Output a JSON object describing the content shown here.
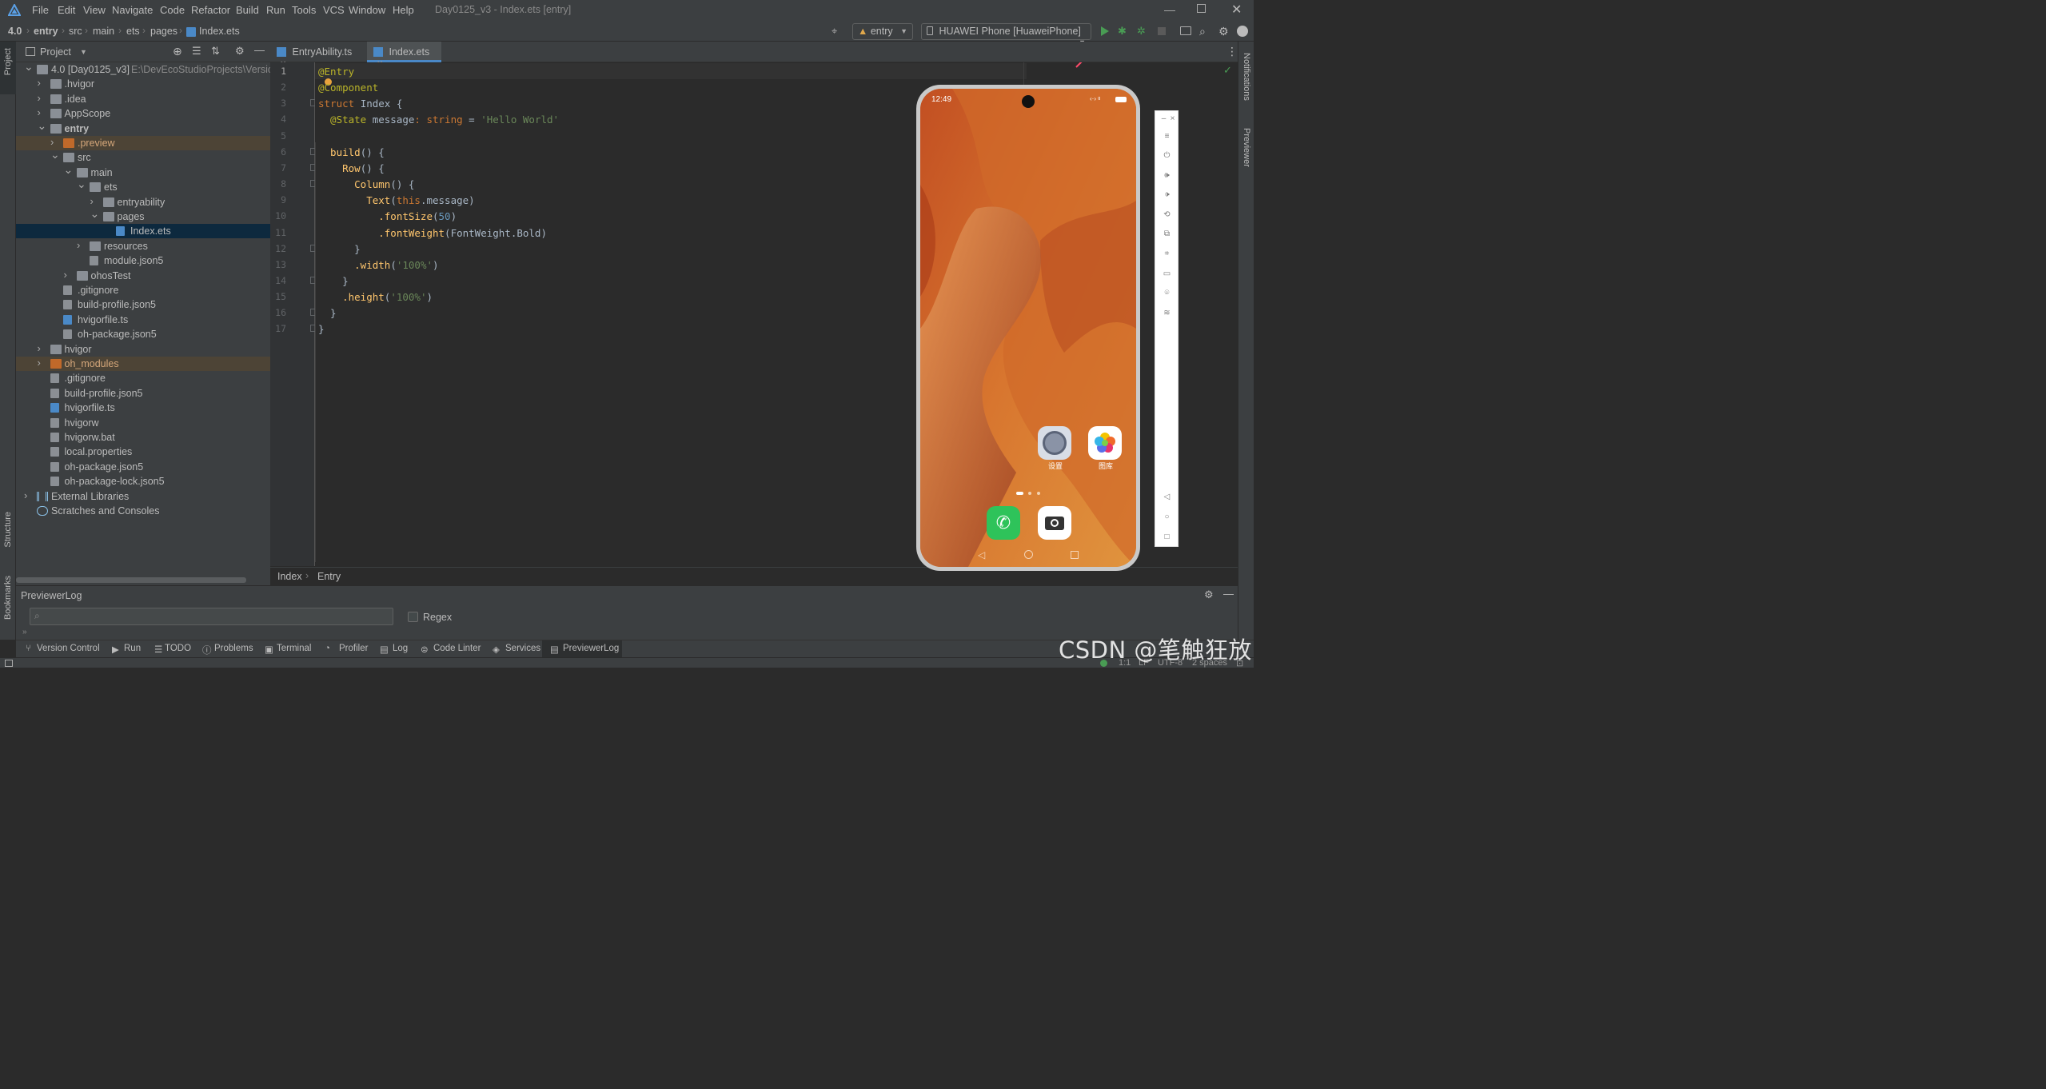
{
  "menu": [
    "File",
    "Edit",
    "View",
    "Navigate",
    "Code",
    "Refactor",
    "Build",
    "Run",
    "Tools",
    "VCS",
    "Window",
    "Help"
  ],
  "window_title": "Day0125_v3 - Index.ets [entry]",
  "breadcrumb": {
    "root": "4.0",
    "items": [
      "entry",
      "src",
      "main",
      "ets",
      "pages",
      "Index.ets"
    ]
  },
  "toolbar": {
    "module": "entry",
    "device": "HUAWEI Phone [HuaweiPhone]",
    "run_color": "#499c54"
  },
  "left_strip": {
    "project": "Project",
    "structure": "Structure",
    "bookmarks": "Bookmarks"
  },
  "right_strip": {
    "notifications": "Notifications",
    "previewer": "Previewer"
  },
  "project_panel": {
    "title": "Project",
    "tree": [
      {
        "depth": 0,
        "expanded": true,
        "type": "folder",
        "label": "4.0 [Day0125_v3]",
        "hint": "E:\\DevEcoStudioProjects\\Version3"
      },
      {
        "depth": 1,
        "expanded": false,
        "type": "folder",
        "label": ".hvigor"
      },
      {
        "depth": 1,
        "expanded": false,
        "type": "folder",
        "label": ".idea"
      },
      {
        "depth": 1,
        "expanded": false,
        "type": "folder",
        "label": "AppScope"
      },
      {
        "depth": 1,
        "expanded": true,
        "type": "folder",
        "label": "entry",
        "bold": true
      },
      {
        "depth": 2,
        "expanded": false,
        "type": "folder-o",
        "label": ".preview",
        "hl": "orange"
      },
      {
        "depth": 2,
        "expanded": true,
        "type": "folder",
        "label": "src"
      },
      {
        "depth": 3,
        "expanded": true,
        "type": "folder",
        "label": "main"
      },
      {
        "depth": 4,
        "expanded": true,
        "type": "folder",
        "label": "ets"
      },
      {
        "depth": 5,
        "expanded": false,
        "type": "folder",
        "label": "entryability"
      },
      {
        "depth": 5,
        "expanded": true,
        "type": "folder",
        "label": "pages"
      },
      {
        "depth": 6,
        "type": "file-ts",
        "label": "Index.ets",
        "hl": "selected"
      },
      {
        "depth": 4,
        "expanded": false,
        "type": "folder",
        "label": "resources"
      },
      {
        "depth": 4,
        "type": "file",
        "label": "module.json5"
      },
      {
        "depth": 3,
        "expanded": false,
        "type": "folder",
        "label": "ohosTest"
      },
      {
        "depth": 2,
        "type": "file",
        "label": ".gitignore"
      },
      {
        "depth": 2,
        "type": "file",
        "label": "build-profile.json5"
      },
      {
        "depth": 2,
        "type": "file-ts",
        "label": "hvigorfile.ts"
      },
      {
        "depth": 2,
        "type": "file",
        "label": "oh-package.json5"
      },
      {
        "depth": 1,
        "expanded": false,
        "type": "folder",
        "label": "hvigor"
      },
      {
        "depth": 1,
        "expanded": false,
        "type": "folder-o",
        "label": "oh_modules",
        "hl": "orange"
      },
      {
        "depth": 1,
        "type": "file",
        "label": ".gitignore"
      },
      {
        "depth": 1,
        "type": "file",
        "label": "build-profile.json5"
      },
      {
        "depth": 1,
        "type": "file-ts",
        "label": "hvigorfile.ts"
      },
      {
        "depth": 1,
        "type": "file",
        "label": "hvigorw"
      },
      {
        "depth": 1,
        "type": "file",
        "label": "hvigorw.bat"
      },
      {
        "depth": 1,
        "type": "file",
        "label": "local.properties"
      },
      {
        "depth": 1,
        "type": "file",
        "label": "oh-package.json5"
      },
      {
        "depth": 1,
        "type": "file",
        "label": "oh-package-lock.json5"
      },
      {
        "depth": 0,
        "expanded": false,
        "type": "lib",
        "label": "External Libraries"
      },
      {
        "depth": 0,
        "type": "scratch",
        "label": "Scratches and Consoles"
      }
    ]
  },
  "tabs": [
    {
      "label": "EntryAbility.ts",
      "active": false
    },
    {
      "label": "Index.ets",
      "active": true
    }
  ],
  "code": [
    [
      [
        "@Entry",
        "#bbb529"
      ]
    ],
    [
      [
        "@Component",
        "#bbb529"
      ]
    ],
    [
      [
        "struct ",
        "#cc7832"
      ],
      [
        "Index ",
        "#a9b7c6"
      ],
      [
        "{",
        "#a9b7c6"
      ]
    ],
    [
      [
        "  @State ",
        "#bbb529"
      ],
      [
        "message",
        "#a9b7c6"
      ],
      [
        ": ",
        "#cc7832"
      ],
      [
        "string",
        "#cc7832"
      ],
      [
        " = ",
        "#a9b7c6"
      ],
      [
        "'Hello World'",
        "#6a8759"
      ]
    ],
    [],
    [
      [
        "  build",
        "#ffc66d"
      ],
      [
        "() {",
        "#a9b7c6"
      ]
    ],
    [
      [
        "    Row",
        "#ffc66d"
      ],
      [
        "() {",
        "#a9b7c6"
      ]
    ],
    [
      [
        "      Column",
        "#ffc66d"
      ],
      [
        "() {",
        "#a9b7c6"
      ]
    ],
    [
      [
        "        Text",
        "#ffc66d"
      ],
      [
        "(",
        "#a9b7c6"
      ],
      [
        "this",
        "#cc7832"
      ],
      [
        ".message)",
        "#a9b7c6"
      ]
    ],
    [
      [
        "          .fontSize",
        "#ffc66d"
      ],
      [
        "(",
        "#a9b7c6"
      ],
      [
        "50",
        "#6897bb"
      ],
      [
        ")",
        "#a9b7c6"
      ]
    ],
    [
      [
        "          .fontWeight",
        "#ffc66d"
      ],
      [
        "(FontWeight.Bold)",
        "#a9b7c6"
      ]
    ],
    [
      [
        "      }",
        "#a9b7c6"
      ]
    ],
    [
      [
        "      .width",
        "#ffc66d"
      ],
      [
        "(",
        "#a9b7c6"
      ],
      [
        "'100%'",
        "#6a8759"
      ],
      [
        ")",
        "#a9b7c6"
      ]
    ],
    [
      [
        "    }",
        "#a9b7c6"
      ]
    ],
    [
      [
        "    .height",
        "#ffc66d"
      ],
      [
        "(",
        "#a9b7c6"
      ],
      [
        "'100%'",
        "#6a8759"
      ],
      [
        ")",
        "#a9b7c6"
      ]
    ],
    [
      [
        "  }",
        "#a9b7c6"
      ]
    ],
    [
      [
        "}",
        "#a9b7c6"
      ]
    ]
  ],
  "editor_breadcrumb": [
    "Index",
    "Entry"
  ],
  "phone": {
    "time": "12:49",
    "apps": [
      {
        "label": "设置",
        "icon": "settings-icon"
      },
      {
        "label": "图库",
        "icon": "gallery-icon"
      }
    ],
    "dock": [
      {
        "icon": "phone-icon"
      },
      {
        "icon": "camera-icon"
      }
    ]
  },
  "log": {
    "title": "PreviewerLog",
    "search_placeholder": "",
    "regex": "Regex"
  },
  "bottom_tabs": [
    "Version Control",
    "Run",
    "TODO",
    "Problems",
    "Terminal",
    "Profiler",
    "Log",
    "Code Linter",
    "Services",
    "PreviewerLog"
  ],
  "status": {
    "position": "1:1",
    "line_sep": "LF",
    "encoding": "UTF-8",
    "indent": "2 spaces"
  },
  "watermark": "CSDN @笔触狂放"
}
